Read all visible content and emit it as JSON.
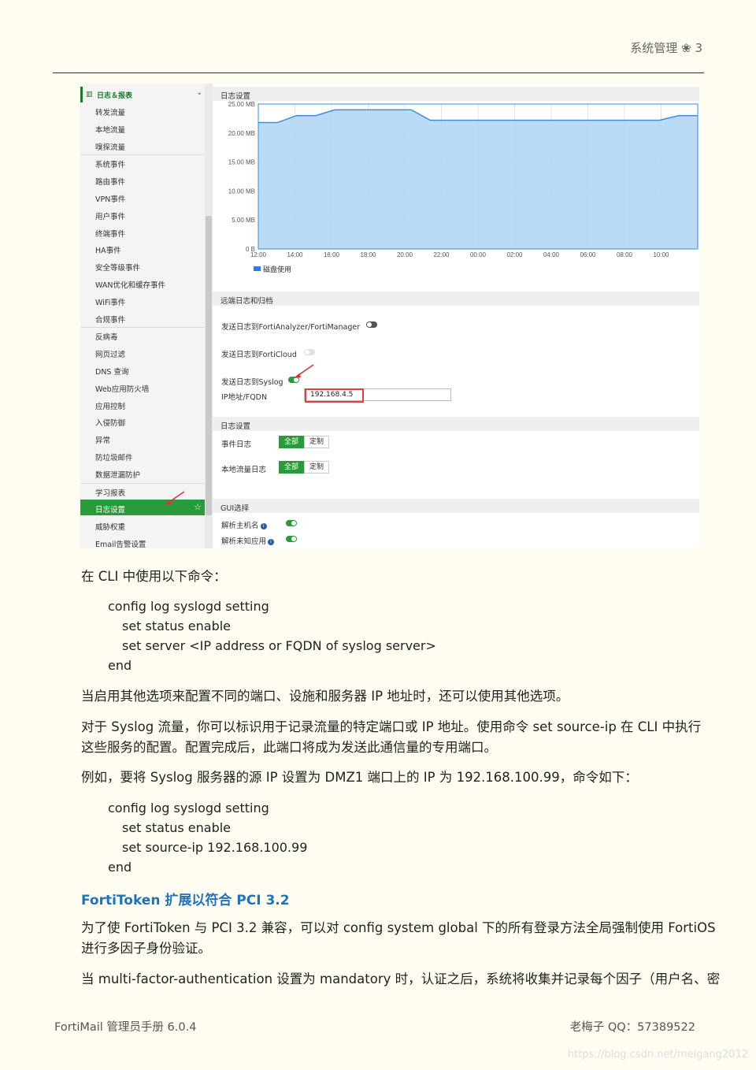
{
  "header": {
    "title": "系统管理",
    "page": "3"
  },
  "screenshot": {
    "sidebar": {
      "head": "日志＆报表",
      "items": [
        "转发流量",
        "本地流量",
        "嗅探流量",
        "系统事件",
        "路由事件",
        "VPN事件",
        "用户事件",
        "终端事件",
        "HA事件",
        "安全等级事件",
        "WAN优化和缓存事件",
        "WiFi事件",
        "合规事件",
        "反病毒",
        "网页过滤",
        "DNS 查询",
        "Web应用防火墙",
        "应用控制",
        "入侵防御",
        "异常",
        "防垃圾邮件",
        "数据泄漏防护",
        "学习报表",
        "日志设置",
        "威胁权重",
        "Email告警设置"
      ],
      "active": "日志设置"
    },
    "sections": {
      "disk": "日志设置",
      "remote": "远端日志和归档",
      "settings": "日志设置",
      "gui": "GUI选择"
    },
    "rows": {
      "faz": "发送日志到FortiAnalyzer/FortiManager",
      "cloud": "发送日志到FortiCloud",
      "syslog": "发送日志到Syslog",
      "ip_label": "IP地址/FQDN",
      "ip_value": "192.168.4.5",
      "event_log": "事件日志",
      "local_log": "本地流量日志",
      "all": "全部",
      "custom": "定制",
      "resolve_host": "解析主机名",
      "resolve_app": "解析未知应用"
    }
  },
  "chart_data": {
    "type": "area",
    "title": "",
    "xlabel": "",
    "ylabel": "",
    "y_ticks": [
      "0 B",
      "5.00 MB",
      "10.00 MB",
      "15.00 MB",
      "20.00 MB",
      "25.00 MB"
    ],
    "ylim": [
      0,
      25
    ],
    "x": [
      "12:00",
      "14:00",
      "16:00",
      "18:00",
      "20:00",
      "22:00",
      "00:00",
      "02:00",
      "04:00",
      "06:00",
      "08:00",
      "10:00"
    ],
    "series": [
      {
        "name": "磁盘使用",
        "values": [
          21.8,
          21.8,
          23.0,
          23.0,
          24.0,
          24.0,
          24.0,
          24.0,
          24.0,
          22.2,
          22.2,
          22.2,
          22.2,
          22.2,
          22.2,
          22.2,
          22.2,
          22.2,
          22.2,
          22.2,
          22.2,
          22.2,
          23.0,
          23.0
        ]
      }
    ],
    "grid": true,
    "legend": "bottom-left",
    "color": "#aed3f4"
  },
  "body": {
    "p1": "在 CLI 中使用以下命令：",
    "code1": [
      "config log syslogd setting",
      "set status enable",
      "set server <IP address or FQDN of syslog server>",
      "end"
    ],
    "p2": "当启用其他选项来配置不同的端口、设施和服务器 IP 地址时，还可以使用其他选项。",
    "p3a": "对于 Syslog 流量，你可以标识用于记录流量的特定端口或 IP 地址。使用命令 set source-ip 在 CLI 中执行",
    "p3b": "这些服务的配置。配置完成后，此端口将成为发送此通信量的专用端口。",
    "p4": "例如，要将 Syslog 服务器的源 IP 设置为 DMZ1 端口上的 IP 为 192.168.100.99，命令如下：",
    "code2": [
      "config log syslogd setting",
      "set status enable",
      "set source-ip 192.168.100.99",
      "end"
    ],
    "subtitle": "FortiToken 扩展以符合 PCI 3.2",
    "p5a": "为了使 FortiToken 与 PCI 3.2 兼容，可以对 config system global 下的所有登录方法全局强制使用 FortiOS",
    "p5b": "进行多因子身份验证。",
    "p6": "当 multi-factor-authentication 设置为 mandatory 时，认证之后，系统将收集并记录每个因子（用户名、密"
  },
  "footer": {
    "left": "FortiMail 管理员手册 6.0.4",
    "right": "老梅子 QQ：57389522",
    "watermark": "https://blog.csdn.net/meigang2012"
  }
}
